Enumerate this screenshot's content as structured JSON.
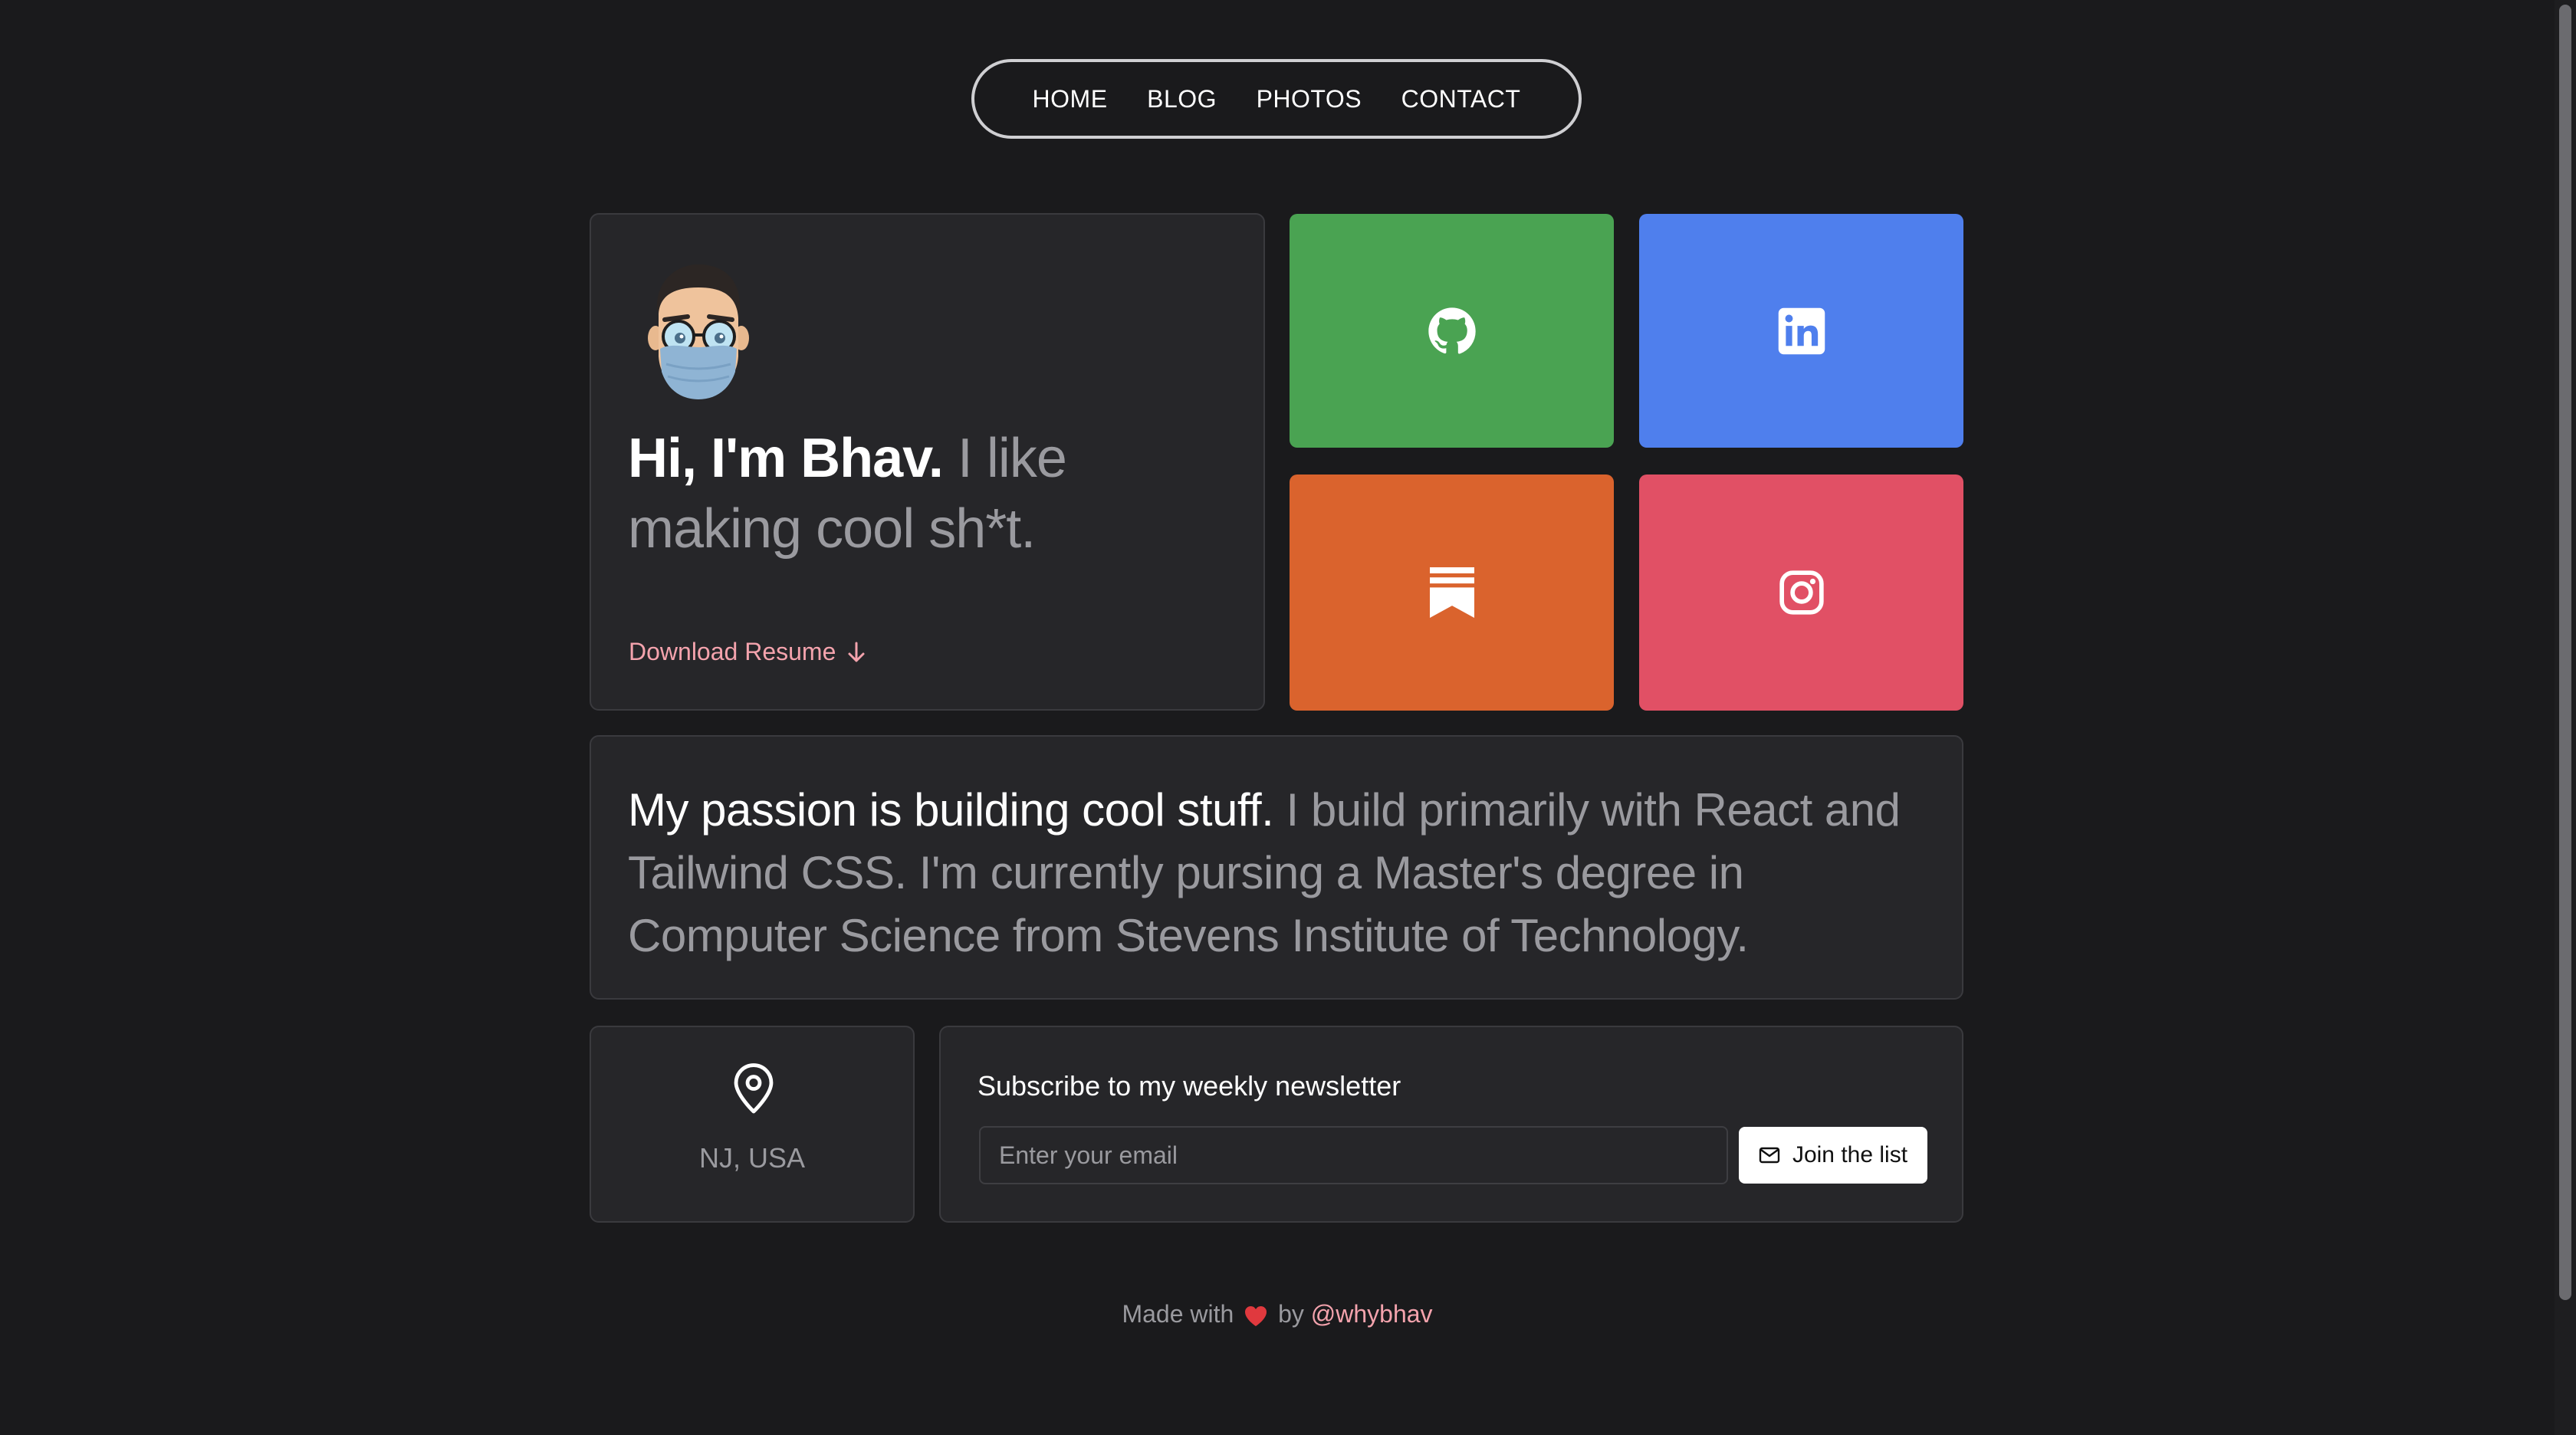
{
  "nav": {
    "items": [
      {
        "label": "HOME"
      },
      {
        "label": "BLOG"
      },
      {
        "label": "PHOTOS"
      },
      {
        "label": "CONTACT"
      }
    ]
  },
  "intro": {
    "greeting_strong": "Hi, I'm Bhav.",
    "greeting_muted": "I like making cool sh*t.",
    "resume_label": "Download Resume",
    "avatar_icon": "memoji-avatar-icon"
  },
  "socials": [
    {
      "name": "GitHub",
      "icon": "github-icon",
      "color": "#4aa352"
    },
    {
      "name": "LinkedIn",
      "icon": "linkedin-icon",
      "color": "#4f7fed"
    },
    {
      "name": "Substack",
      "icon": "substack-icon",
      "color": "#da632d"
    },
    {
      "name": "Instagram",
      "icon": "instagram-icon",
      "color": "#e15065"
    }
  ],
  "passion": {
    "strong": "My passion is building cool stuff.",
    "muted": "I build primarily with React and Tailwind CSS. I'm currently pursing a Master's degree in Computer Science from Stevens Institute of Technology."
  },
  "location": {
    "icon": "map-pin-icon",
    "text": "NJ, USA"
  },
  "newsletter": {
    "title": "Subscribe to my weekly newsletter",
    "placeholder": "Enter your email",
    "button_label": "Join the list",
    "button_icon": "mail-icon"
  },
  "footer": {
    "prefix": "Made with",
    "middle": "by",
    "handle": "@whybhav",
    "heart_icon": "heart-icon"
  },
  "colors": {
    "background": "#1a1a1c",
    "card": "#262629",
    "accent_pink": "#f4a3ad",
    "muted_text": "#9a9a9f"
  }
}
